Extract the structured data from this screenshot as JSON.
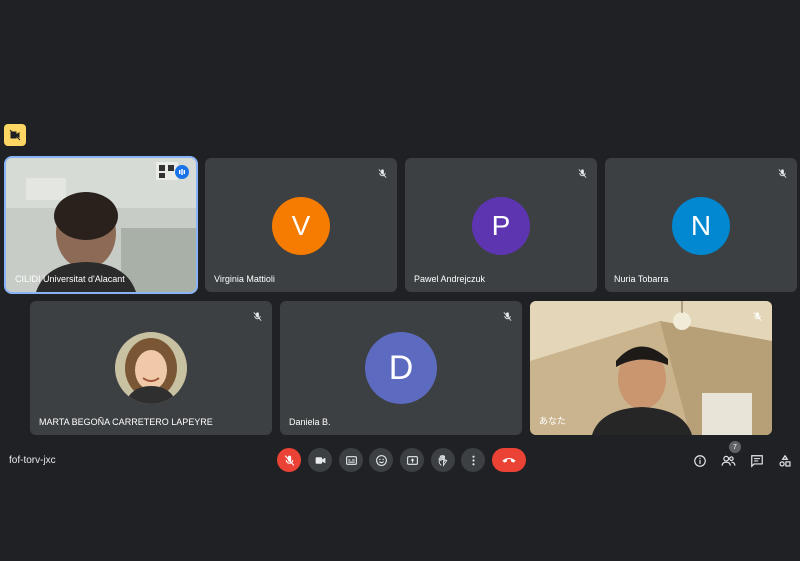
{
  "meeting": {
    "code": "fof-torv-jxc",
    "participant_count": "7"
  },
  "participants": [
    {
      "name": "CILIDI Universitat d'Alacant",
      "type": "video",
      "speaking": true
    },
    {
      "name": "Virginia Mattioli",
      "initial": "V",
      "color": "#f57c00",
      "muted": true
    },
    {
      "name": "Pawel Andrejczuk",
      "initial": "P",
      "color": "#5e35b1",
      "muted": true
    },
    {
      "name": "Nuria Tobarra",
      "initial": "N",
      "color": "#0288d1",
      "muted": true
    },
    {
      "name": "MARTA BEGOÑA CARRETERO LAPEYRE",
      "type": "photo",
      "muted": true
    },
    {
      "name": "Daniela B.",
      "initial": "D",
      "color": "#5c6bc0",
      "muted": true
    },
    {
      "name": "あなた",
      "type": "video",
      "muted": true
    }
  ],
  "controls": {
    "items": [
      "mic-off-icon",
      "camera-icon",
      "captions-icon",
      "emoji-icon",
      "present-icon",
      "hand-icon",
      "more-icon",
      "end-call-icon"
    ]
  },
  "colors": {
    "background": "#202124",
    "tile": "#3c4043",
    "danger": "#ea4335",
    "accent": "#8ab4f8"
  }
}
